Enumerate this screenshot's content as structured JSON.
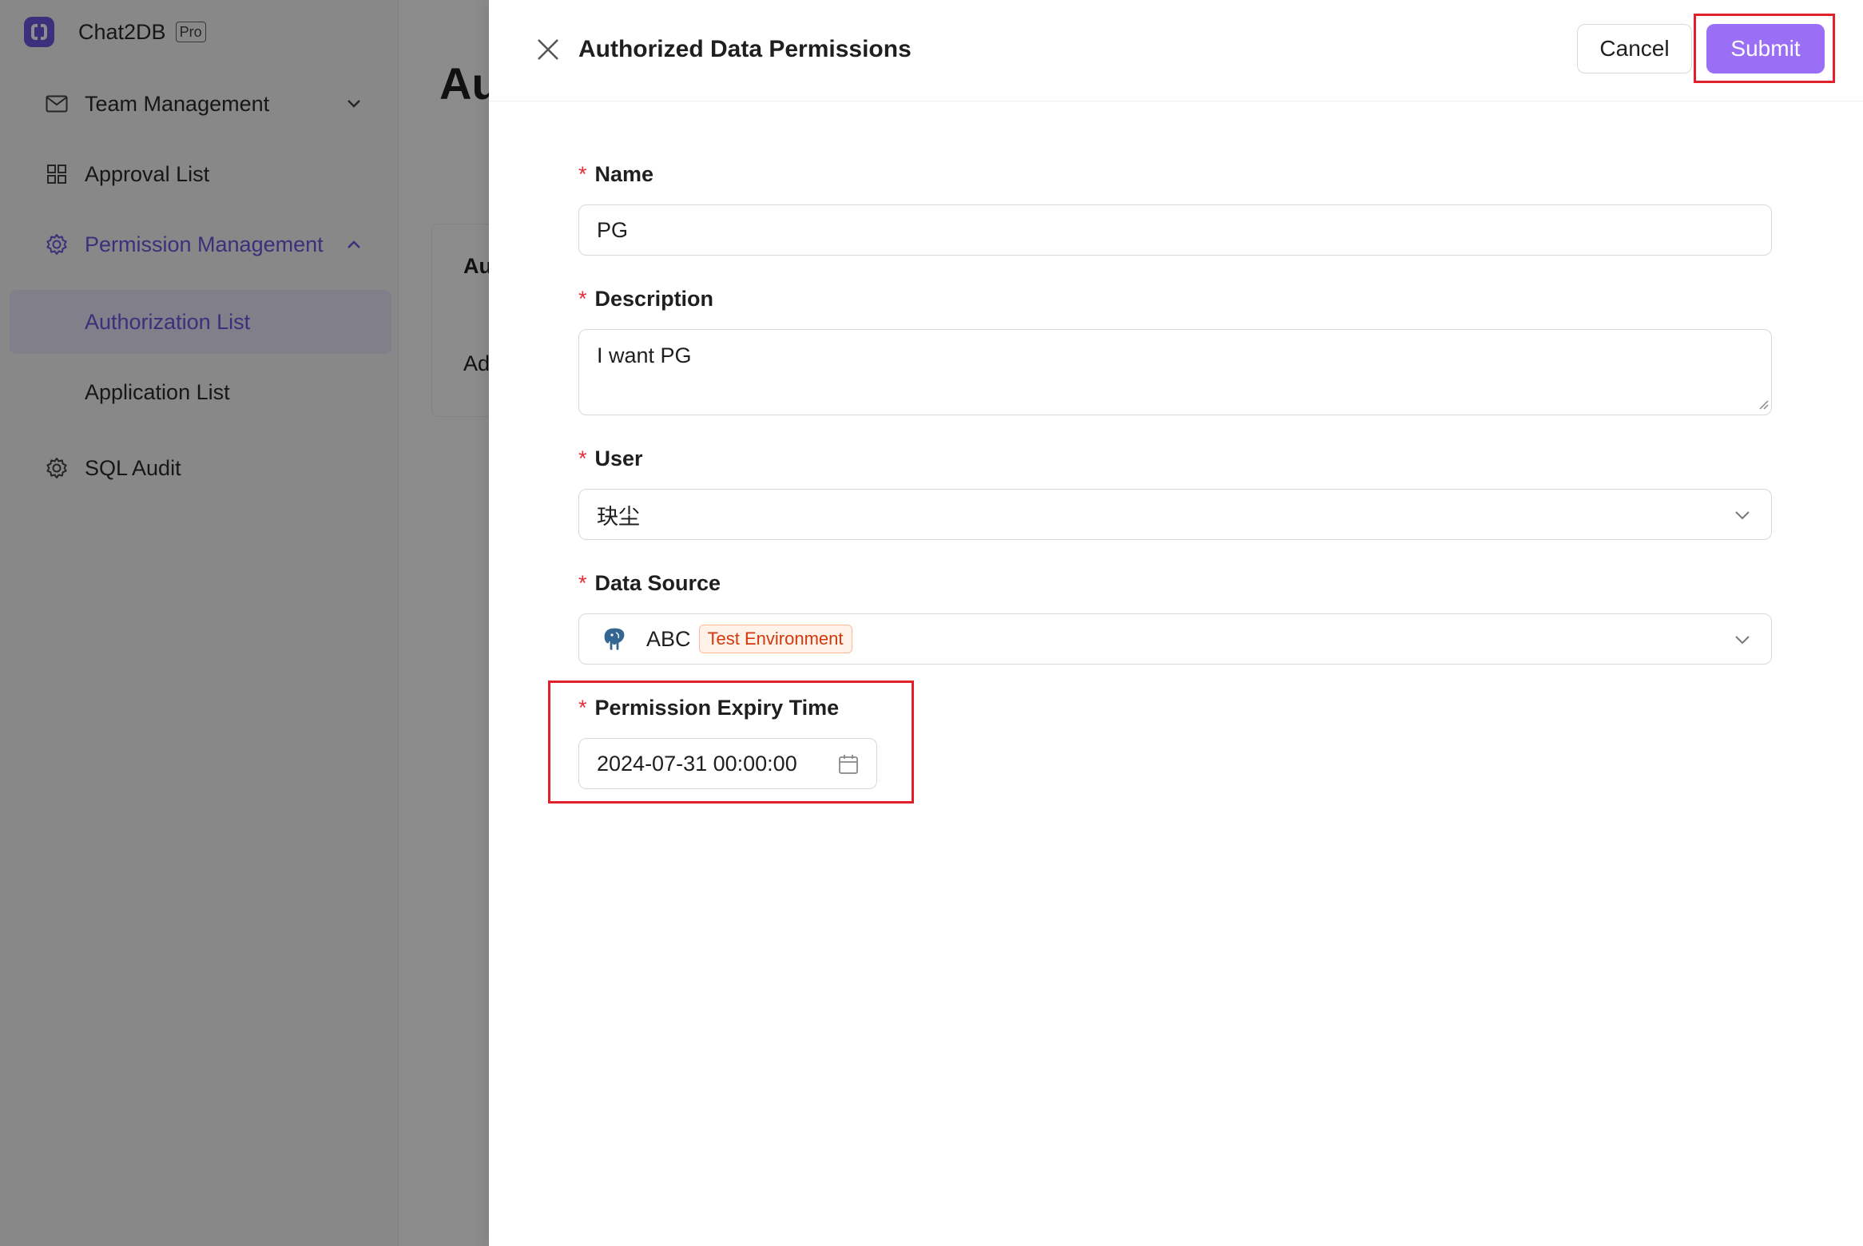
{
  "sidebar": {
    "brand_name": "Chat2DB",
    "brand_badge": "Pro",
    "items": [
      {
        "label": "Team Management",
        "icon": "mail-icon"
      },
      {
        "label": "Approval List",
        "icon": "grid-icon"
      },
      {
        "label": "Permission Management",
        "icon": "gear-icon"
      },
      {
        "label": "Authorization List"
      },
      {
        "label": "Application List"
      },
      {
        "label": "SQL Audit",
        "icon": "gear-icon"
      }
    ]
  },
  "main": {
    "title": "Au",
    "row1": "Au",
    "row2": "Ad"
  },
  "drawer": {
    "title": "Authorized Data Permissions",
    "cancel_label": "Cancel",
    "submit_label": "Submit",
    "fields": {
      "name": {
        "label": "Name",
        "required": "*",
        "value": "PG"
      },
      "description": {
        "label": "Description",
        "required": "*",
        "value": "I want PG"
      },
      "user": {
        "label": "User",
        "required": "*",
        "value": "玦尘"
      },
      "data_source": {
        "label": "Data Source",
        "required": "*",
        "value": "ABC",
        "tag": "Test Environment",
        "icon": "postgresql-icon"
      },
      "expiry": {
        "label": "Permission Expiry Time",
        "required": "*",
        "value": "2024-07-31 00:00:00"
      }
    }
  },
  "colors": {
    "accent": "#9a6ff5",
    "brand": "#6d56e0",
    "required": "#e0303a",
    "highlight": "#e0202a",
    "tag_text": "#d4380d",
    "tag_bg": "#fff2e8"
  }
}
